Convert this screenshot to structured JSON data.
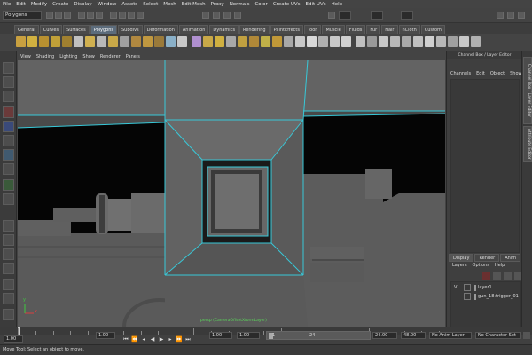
{
  "menubar": [
    "File",
    "Edit",
    "Modify",
    "Create",
    "Display",
    "Window",
    "Assets",
    "Select",
    "Mesh",
    "Edit Mesh",
    "Proxy",
    "Normals",
    "Color",
    "Create UVs",
    "Edit UVs",
    "Help"
  ],
  "status": {
    "mode": "Polygons"
  },
  "shelf": {
    "tabs": [
      "General",
      "Curves",
      "Surfaces",
      "Polygons",
      "Subdivs",
      "Deformation",
      "Animation",
      "Dynamics",
      "Rendering",
      "PaintEffects",
      "Toon",
      "Muscle",
      "Fluids",
      "Fur",
      "Hair",
      "nCloth",
      "Custom"
    ],
    "active_tab": "Polygons"
  },
  "viewport": {
    "menu": [
      "View",
      "Shading",
      "Lighting",
      "Show",
      "Renderer",
      "Panels"
    ],
    "camera_label": "persp (CameraOffsetXformLayer)",
    "axis_x": "x",
    "axis_y": "y"
  },
  "channel_box": {
    "header": "Channel Box / Layer Editor",
    "menu": [
      "Channels",
      "Edit",
      "Object",
      "Show"
    ]
  },
  "layers": {
    "tabs": [
      "Display",
      "Render",
      "Anim"
    ],
    "menu": [
      "Layers",
      "Options",
      "Help"
    ],
    "rows": [
      {
        "visible": "V",
        "name": "layer1"
      },
      {
        "visible": "",
        "name": "gun_18:trigger_01"
      }
    ]
  },
  "side_tabs": [
    "Channel Box / Layer Editor",
    "Attribute Editor"
  ],
  "timeline": {
    "marker_start": "1",
    "marker_24": "24",
    "range_start": "1.00",
    "range_inner_start": "1.00",
    "current": "1.00",
    "range_inner_end": "24.00",
    "range_end": "48.00",
    "frame_field": "1.00",
    "anim_layer": "No Anim Layer",
    "char_set": "No Character Set"
  },
  "help_line": "Move Tool: Select an object to move.",
  "colors": {
    "selection_wire": "#38c8d8",
    "viewport_bg": "#555555",
    "accent_tab": "#5c6c7c"
  }
}
